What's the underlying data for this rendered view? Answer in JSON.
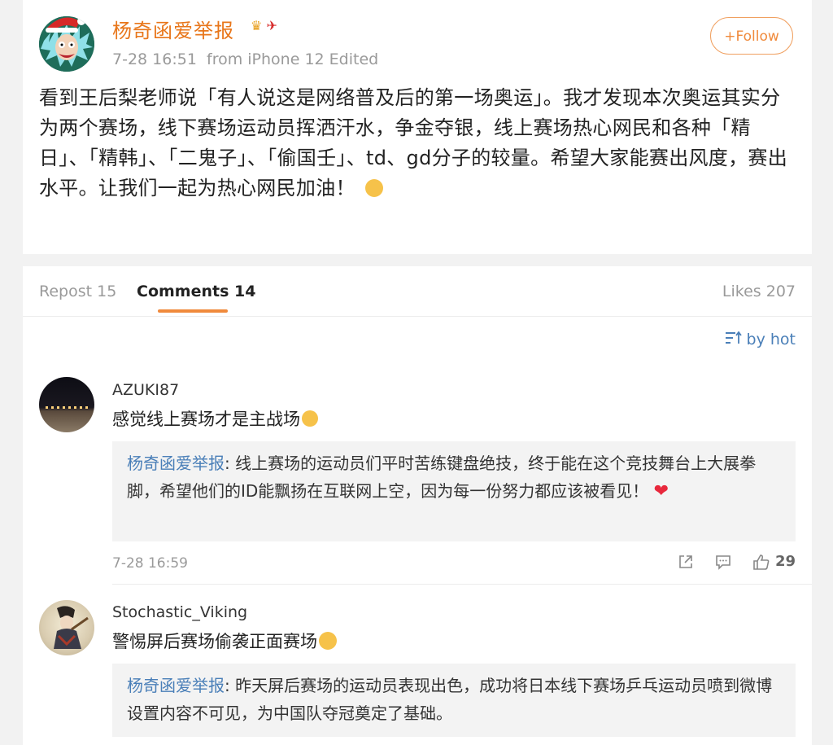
{
  "post": {
    "author": "杨奇函爱举报",
    "time": "7-28 16:51",
    "source": "from iPhone 12",
    "edited": "Edited",
    "follow_label": "+Follow",
    "text": "看到王后梨老师说「有人说这是网络普及后的第一场奥运」。我才发现本次奥运其实分为两个赛场，线下赛场运动员挥洒汗水，争金夺银，线上赛场热心网民和各种「精日」、「精韩」、「二鬼子」、「偷国壬」、td、gd分子的较量。希望大家能赛出风度，赛出水平。让我们一起为热心网民加油！"
  },
  "tabs": {
    "repost": "Repost 15",
    "comments": "Comments 14",
    "likes": "Likes 207"
  },
  "sort_label": "by hot",
  "comments": [
    {
      "user": "AZUKI87",
      "text": "感觉线上赛场才是主战场",
      "reply_author": "杨奇函爱举报",
      "reply_text": ": 线上赛场的运动员们平时苦练键盘绝技，终于能在这个竞技舞台上大展拳脚，希望他们的ID能飘扬在互联网上空，因为每一份努力都应该被看见！",
      "time": "7-28 16:59",
      "likes": "29"
    },
    {
      "user": "Stochastic_Viking",
      "text": "警惕屏后赛场偷袭正面赛场",
      "reply_author": "杨奇函爱举报",
      "reply_text": ": 昨天屏后赛场的运动员表现出色，成功将日本线下赛场乒乓运动员喷到微博设置内容不可见，为中国队夺冠奠定了基础。"
    }
  ],
  "colors": {
    "accent_orange": "#e8761a",
    "link_blue": "#4a7fb8",
    "heart_red": "#e8283c"
  }
}
